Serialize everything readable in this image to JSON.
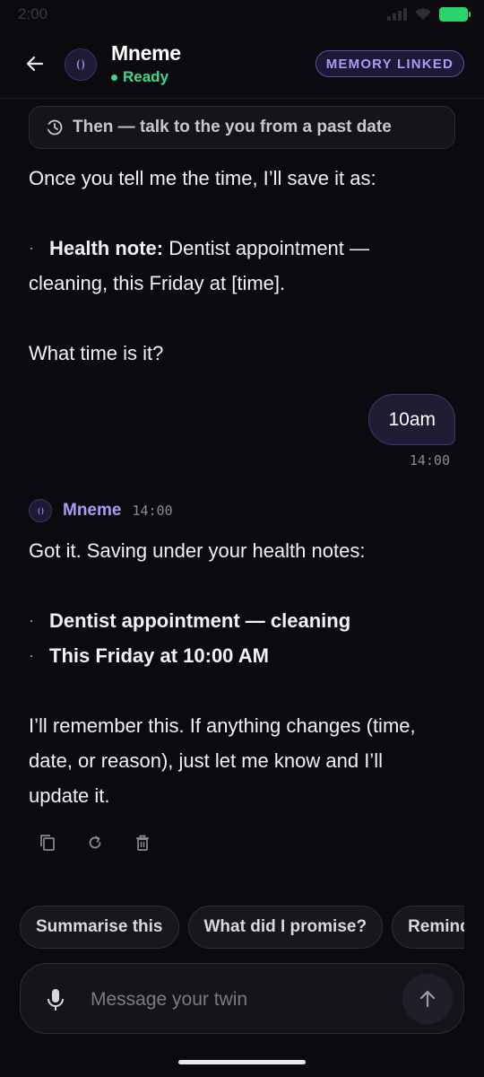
{
  "status_bar": {
    "time": "2:00"
  },
  "header": {
    "title": "Mneme",
    "status": "Ready",
    "badge": "MEMORY LINKED",
    "back_icon": "arrow-left-icon",
    "avatar_icon": "mneme-logo-icon"
  },
  "then_pill": {
    "icon": "history-icon",
    "label": "Then — talk to the you from a past date"
  },
  "messages": {
    "bot_prev": {
      "line1": "Once you tell me the time, I’ll save it as:",
      "bullet_bold": "Health note:",
      "bullet_rest": " Dentist appointment —",
      "bullet_cont": "cleaning, this Friday at [time].",
      "question": "What time is it?"
    },
    "user": {
      "text": "10am",
      "time": "14:00"
    },
    "bot": {
      "name": "Mneme",
      "time": "14:00",
      "intro": "Got it. Saving under your health notes:",
      "bullets": [
        "Dentist appointment — cleaning",
        "This Friday at 10:00 AM"
      ],
      "outro_lines": [
        "I’ll remember this. If anything changes (time,",
        "date, or reason), just let me know and I’ll",
        "update it."
      ]
    }
  },
  "actions": {
    "copy_icon": "copy-icon",
    "regenerate_icon": "refresh-icon",
    "delete_icon": "trash-icon"
  },
  "chips": [
    "Summarise this",
    "What did I promise?",
    "Remind me"
  ],
  "composer": {
    "placeholder": "Message your twin",
    "mic_icon": "mic-icon",
    "send_icon": "arrow-up-icon"
  },
  "colors": {
    "accent": "#a99cf5",
    "status_green": "#3dd68c",
    "background": "#0b0b0f"
  }
}
